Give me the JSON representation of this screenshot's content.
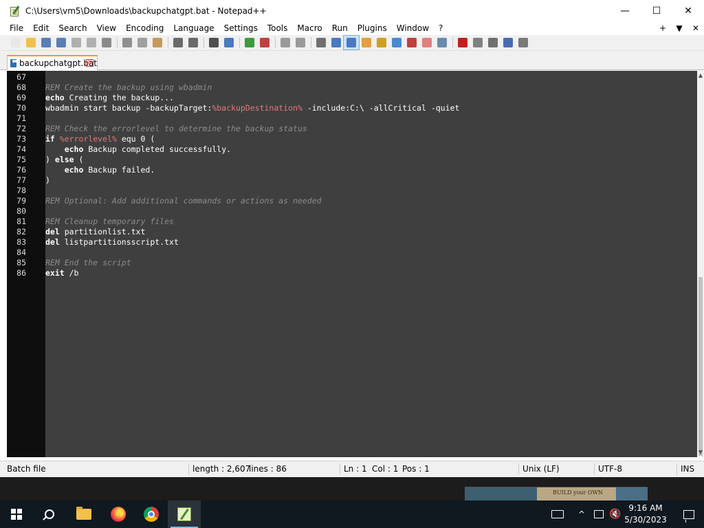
{
  "window": {
    "title": "C:\\Users\\vm5\\Downloads\\backupchatgpt.bat - Notepad++",
    "minimize": "—",
    "maximize": "☐",
    "close": "✕"
  },
  "menu": {
    "items": [
      "File",
      "Edit",
      "Search",
      "View",
      "Encoding",
      "Language",
      "Settings",
      "Tools",
      "Macro",
      "Run",
      "Plugins",
      "Window",
      "?"
    ],
    "right": [
      "+",
      "▼",
      "✕"
    ]
  },
  "toolbar": {
    "buttons": [
      {
        "name": "new-file-icon",
        "color": "#e8e8e8"
      },
      {
        "name": "open-file-icon",
        "color": "#f2c04b"
      },
      {
        "name": "save-icon",
        "color": "#5a7fb5"
      },
      {
        "name": "save-all-icon",
        "color": "#5a7fb5"
      },
      {
        "name": "close-icon",
        "color": "#b0b0b0"
      },
      {
        "name": "close-all-icon",
        "color": "#b0b0b0"
      },
      {
        "name": "print-icon",
        "color": "#8a8a8a"
      },
      {
        "name": "cut-icon",
        "color": "#909090"
      },
      {
        "name": "copy-icon",
        "color": "#a0a0a0"
      },
      {
        "name": "paste-icon",
        "color": "#c49a5a"
      },
      {
        "name": "undo-icon",
        "color": "#6a6a6a"
      },
      {
        "name": "redo-icon",
        "color": "#6a6a6a"
      },
      {
        "name": "find-icon",
        "color": "#505050"
      },
      {
        "name": "replace-icon",
        "color": "#4a7abf"
      },
      {
        "name": "zoom-in-icon",
        "color": "#3c9a3c"
      },
      {
        "name": "zoom-out-icon",
        "color": "#c04040"
      },
      {
        "name": "sync-vertical-icon",
        "color": "#9a9a9a"
      },
      {
        "name": "sync-horizontal-icon",
        "color": "#9a9a9a"
      },
      {
        "name": "word-wrap-icon",
        "color": "#707070"
      },
      {
        "name": "show-all-characters-icon",
        "color": "#4a7abf"
      },
      {
        "name": "indent-guide-icon",
        "color": "#4a7abf"
      },
      {
        "name": "user-defined-language-icon",
        "color": "#e0a040"
      },
      {
        "name": "document-map-icon",
        "color": "#d0a020"
      },
      {
        "name": "document-list-icon",
        "color": "#4a8ad0"
      },
      {
        "name": "function-list-icon",
        "color": "#c04040"
      },
      {
        "name": "folder-as-workspace-icon",
        "color": "#e08080"
      },
      {
        "name": "monitoring-icon",
        "color": "#6a8aaa"
      },
      {
        "name": "macro-record-icon",
        "color": "#c02020"
      },
      {
        "name": "macro-stop-icon",
        "color": "#808080"
      },
      {
        "name": "macro-play-icon",
        "color": "#707070"
      },
      {
        "name": "macro-play-multiple-icon",
        "color": "#4a6ab0"
      },
      {
        "name": "macro-save-icon",
        "color": "#7a7a7a"
      }
    ]
  },
  "tab": {
    "label": "backupchatgpt.bat",
    "close": "✕"
  },
  "editor": {
    "lines": [
      {
        "n": "67",
        "parts": []
      },
      {
        "n": "68",
        "parts": [
          {
            "t": "REM Create the backup using wbadmin",
            "c": "c"
          }
        ]
      },
      {
        "n": "69",
        "parts": [
          {
            "t": "echo",
            "c": "k"
          },
          {
            "t": " Creating the backup...",
            "c": ""
          }
        ]
      },
      {
        "n": "70",
        "parts": [
          {
            "t": "wbadmin start backup -backupTarget:",
            "c": ""
          },
          {
            "t": "%backupDestination%",
            "c": "v"
          },
          {
            "t": " -include:C:\\ -allCritical -quiet",
            "c": ""
          }
        ]
      },
      {
        "n": "71",
        "parts": []
      },
      {
        "n": "72",
        "parts": [
          {
            "t": "REM Check the errorlevel to determine the backup status",
            "c": "c"
          }
        ]
      },
      {
        "n": "73",
        "parts": [
          {
            "t": "if",
            "c": "k"
          },
          {
            "t": " ",
            "c": ""
          },
          {
            "t": "%errorlevel%",
            "c": "v"
          },
          {
            "t": " equ 0 (",
            "c": ""
          }
        ]
      },
      {
        "n": "74",
        "parts": [
          {
            "t": "    ",
            "c": ""
          },
          {
            "t": "echo",
            "c": "k"
          },
          {
            "t": " Backup completed successfully.",
            "c": ""
          }
        ]
      },
      {
        "n": "75",
        "parts": [
          {
            "t": ") ",
            "c": ""
          },
          {
            "t": "else",
            "c": "k"
          },
          {
            "t": " (",
            "c": ""
          }
        ]
      },
      {
        "n": "76",
        "parts": [
          {
            "t": "    ",
            "c": ""
          },
          {
            "t": "echo",
            "c": "k"
          },
          {
            "t": " Backup failed.",
            "c": ""
          }
        ]
      },
      {
        "n": "77",
        "parts": [
          {
            "t": ")",
            "c": ""
          }
        ]
      },
      {
        "n": "78",
        "parts": []
      },
      {
        "n": "79",
        "parts": [
          {
            "t": "REM Optional: Add additional commands or actions as needed",
            "c": "c"
          }
        ]
      },
      {
        "n": "80",
        "parts": []
      },
      {
        "n": "81",
        "parts": [
          {
            "t": "REM Cleanup temporary files",
            "c": "c"
          }
        ]
      },
      {
        "n": "82",
        "parts": [
          {
            "t": "del",
            "c": "k"
          },
          {
            "t": " partitionlist.txt",
            "c": ""
          }
        ]
      },
      {
        "n": "83",
        "parts": [
          {
            "t": "del",
            "c": "k"
          },
          {
            "t": " listpartitionsscript.txt",
            "c": ""
          }
        ]
      },
      {
        "n": "84",
        "parts": []
      },
      {
        "n": "85",
        "parts": [
          {
            "t": "REM End the script",
            "c": "c"
          }
        ]
      },
      {
        "n": "86",
        "parts": [
          {
            "t": "exit",
            "c": "k"
          },
          {
            "t": " /b",
            "c": ""
          }
        ]
      }
    ]
  },
  "status": {
    "file_type": "Batch file",
    "length": "length : 2,607",
    "lines": "lines : 86",
    "ln": "Ln : 1",
    "col": "Col : 1",
    "pos": "Pos : 1",
    "eol": "Unix (LF)",
    "encoding": "UTF-8",
    "mode": "INS"
  },
  "desktop": {
    "thumbnail_text": "BUILD your OWN"
  },
  "taskbar": {
    "time": "9:16 AM",
    "date": "5/30/2023",
    "tray_chevron": "^"
  },
  "colors": {
    "editor_bg": "#3f3f3f",
    "gutter_bg": "#0e0e0e",
    "comment": "#8b8b8b",
    "variable": "#e07a7a",
    "tab_accent": "#f39c12",
    "taskbar_bg": "#101820"
  }
}
